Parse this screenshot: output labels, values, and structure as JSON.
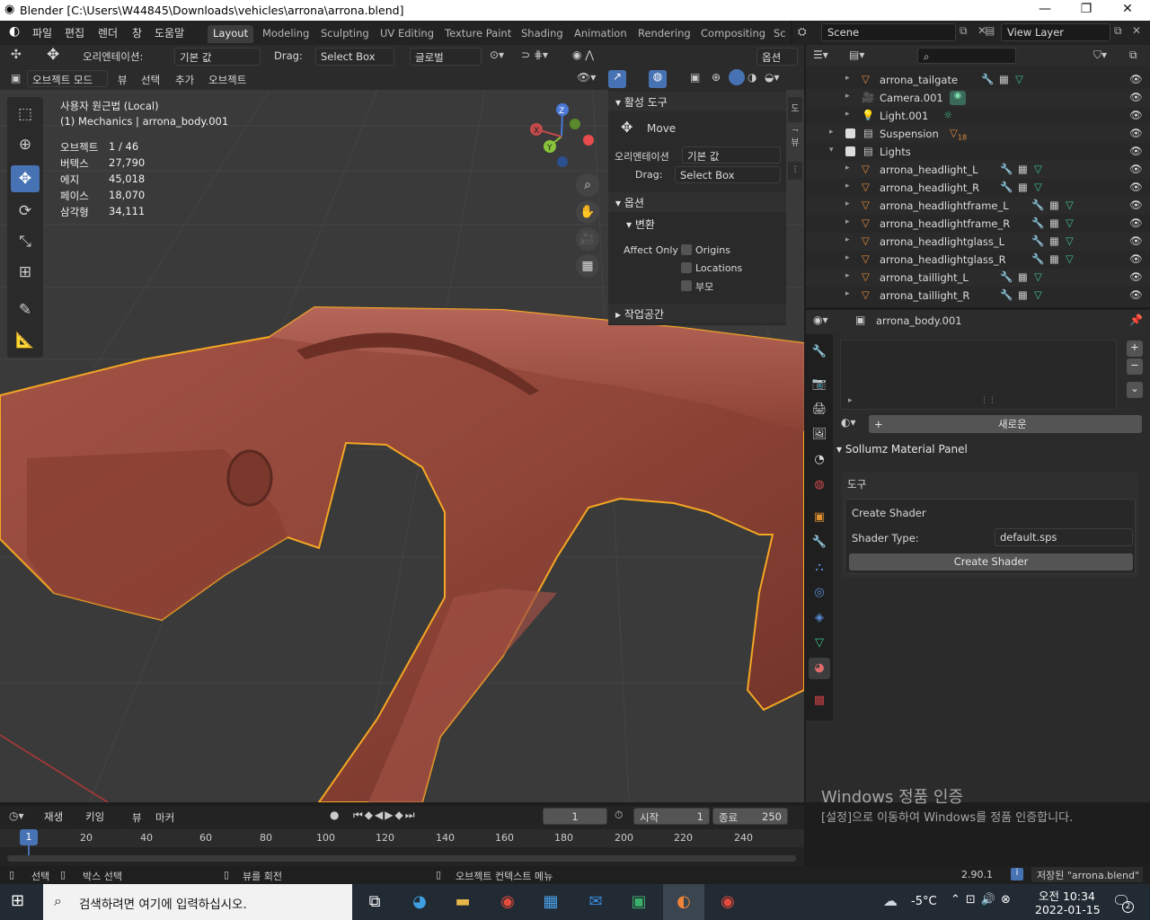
{
  "window": {
    "title": "Blender [C:\\Users\\W44845\\Downloads\\vehicles\\arrona\\arrona.blend]"
  },
  "topbar": {
    "menus": [
      "파일",
      "편집",
      "렌더",
      "창",
      "도움말"
    ],
    "workspaces": [
      "Layout",
      "Modeling",
      "Sculpting",
      "UV Editing",
      "Texture Paint",
      "Shading",
      "Animation",
      "Rendering",
      "Compositing",
      "Sc"
    ],
    "active_workspace": "Layout",
    "scene": "Scene",
    "view_layer": "View Layer"
  },
  "header3d": {
    "orientation_label": "오리엔테이션:",
    "orientation_value": "기본 값",
    "drag_label": "Drag:",
    "drag_value": "Select Box",
    "transform_space": "글로벌",
    "options": "옵션",
    "mode": "오브젝트 모드",
    "view": "뷰",
    "select": "선택",
    "add": "추가",
    "object": "오브젝트"
  },
  "viewport": {
    "view_name": "사용자 원근법 (Local)",
    "context": "(1) Mechanics | arrona_body.001",
    "stats": [
      {
        "label": "오브젝트",
        "value": "1 / 46"
      },
      {
        "label": "버텍스",
        "value": "27,790"
      },
      {
        "label": "에지",
        "value": "45,018"
      },
      {
        "label": "페이스",
        "value": "18,070"
      },
      {
        "label": "삼각형",
        "value": "34,111"
      }
    ],
    "gizmo": {
      "z": "Z",
      "y": "Y",
      "x": "X"
    }
  },
  "npanel": {
    "active_tool": "활성 도구",
    "tool_name": "Move",
    "orientation_label": "오리엔테이션",
    "orientation_value": "기본 값",
    "drag_label": "Drag:",
    "drag_value": "Select Box",
    "options": "옵션",
    "transform": "변환",
    "affect_only": "Affect Only",
    "origins": "Origins",
    "locations": "Locations",
    "parent": "부모",
    "workspace": "작업공간",
    "tabs": [
      "도구",
      "뷰"
    ]
  },
  "outliner": {
    "rows": [
      {
        "name": "arrona_tailgate",
        "type": "mesh",
        "mods": true,
        "indent": 3
      },
      {
        "name": "Camera.001",
        "type": "camera",
        "mods": false,
        "indent": 3
      },
      {
        "name": "Light.001",
        "type": "light",
        "mods": false,
        "indent": 3
      },
      {
        "name": "Suspension",
        "type": "collection",
        "mods": false,
        "indent": 2,
        "badge": "18"
      },
      {
        "name": "Lights",
        "type": "collection",
        "mods": false,
        "indent": 2
      },
      {
        "name": "arrona_headlight_L",
        "type": "mesh",
        "mods": true,
        "indent": 3
      },
      {
        "name": "arrona_headlight_R",
        "type": "mesh",
        "mods": true,
        "indent": 3
      },
      {
        "name": "arrona_headlightframe_L",
        "type": "mesh",
        "mods": true,
        "indent": 3
      },
      {
        "name": "arrona_headlightframe_R",
        "type": "mesh",
        "mods": true,
        "indent": 3
      },
      {
        "name": "arrona_headlightglass_L",
        "type": "mesh",
        "mods": true,
        "indent": 3
      },
      {
        "name": "arrona_headlightglass_R",
        "type": "mesh",
        "mods": true,
        "indent": 3
      },
      {
        "name": "arrona_taillight_L",
        "type": "mesh",
        "mods": true,
        "indent": 3
      },
      {
        "name": "arrona_taillight_R",
        "type": "mesh",
        "mods": true,
        "indent": 3
      }
    ]
  },
  "properties": {
    "object_name": "arrona_body.001",
    "new_button": "새로운",
    "panel_title": "Sollumz Material Panel",
    "tools_label": "도구",
    "create_shader_label": "Create Shader",
    "shader_type_label": "Shader Type:",
    "shader_type_value": "default.sps",
    "create_shader_button": "Create Shader"
  },
  "timeline": {
    "play": "재생",
    "keying": "키잉",
    "view": "뷰",
    "marker": "마커",
    "current_frame": "1",
    "start_label": "시작",
    "start": "1",
    "end_label": "종료",
    "end": "250",
    "ruler": [
      "20",
      "40",
      "60",
      "80",
      "100",
      "120",
      "140",
      "160",
      "180",
      "200",
      "220",
      "240"
    ],
    "cursor_label": "1"
  },
  "statusbar": {
    "select": "선택",
    "box_select": "박스 선택",
    "rotate_view": "뷰를 회전",
    "context_menu": "오브젝트 컨텍스트 메뉴",
    "version": "2.90.1",
    "saved": "저장된 \"arrona.blend\""
  },
  "watermark": {
    "title": "Windows 정품 인증",
    "body": "[설정]으로 이동하여 Windows를 정품 인증합니다."
  },
  "taskbar": {
    "search_placeholder": "검색하려면 여기에 입력하십시오.",
    "weather": "-5°C",
    "time": "오전 10:34",
    "date": "2022-01-15",
    "notif_count": "2"
  },
  "colors": {
    "accent": "#4772b3",
    "selection": "#f5a623",
    "mesh": "#9a4a3e",
    "grid": "#3a3a3a"
  }
}
